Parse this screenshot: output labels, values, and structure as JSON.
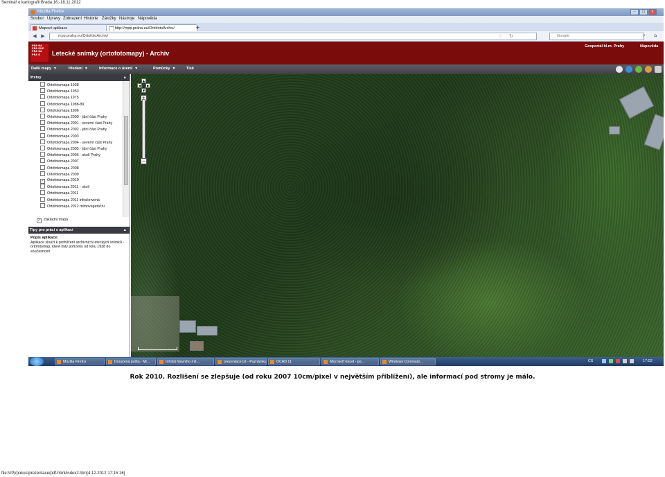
{
  "doc_header": "Seminář o kartografii Brada 16.-18.11.2012",
  "doc_footer": "file:///P|/pokus/prezentace/pdf-html/index2.htm[4.12.2012 17:15:16]",
  "caption": "Rok 2010. Rozlišení se zlepšuje (od roku 2007 10cm/pixel v největším přiblížení), ale informací pod stromy je málo.",
  "browser": {
    "window_title": "Mozilla Firefox",
    "menu": [
      "Soubor",
      "Úpravy",
      "Zobrazení",
      "Historie",
      "Záložky",
      "Nástroje",
      "Nápověda"
    ],
    "tabs": [
      "Mapové aplikace",
      "http://mpp.praha.eu/OrtofotoArchiv/"
    ],
    "new_tab": "+",
    "url": "mpp.praha.eu/OrtofotoArchiv/",
    "search_placeholder": "Google"
  },
  "app": {
    "logo_text": "PRA HA PRA GUE PRA GA PRA G",
    "title": "Letecké snímky (ortofotomapy) - Archiv",
    "portal_link": "Geoportál hl.m. Prahy",
    "help_link": "Nápověda",
    "toolbar": [
      "Další mapy",
      "Hledání",
      "Informace o území",
      "Pomůcky",
      "Tisk"
    ]
  },
  "sidebar": {
    "layers_heading": "Vrstvy",
    "layers": [
      {
        "label": "Ortofotomapa 1938",
        "checked": false
      },
      {
        "label": "Ortofotomapa 1953",
        "checked": false
      },
      {
        "label": "Ortofotomapa 1975",
        "checked": false
      },
      {
        "label": "Ortofotomapa 1988-89",
        "checked": false
      },
      {
        "label": "Ortofotomapa 1996",
        "checked": false
      },
      {
        "label": "Ortofotomapa 2000 - jižní část Prahy",
        "checked": false
      },
      {
        "label": "Ortofotomapa 2001 - severní část Prahy",
        "checked": false
      },
      {
        "label": "Ortofotomapa 2002 - jižní část Prahy",
        "checked": false
      },
      {
        "label": "Ortofotomapa 2003",
        "checked": false
      },
      {
        "label": "Ortofotomapa 2004 - severní část Prahy",
        "checked": false
      },
      {
        "label": "Ortofotomapa 2005 - jižní část Prahy",
        "checked": false
      },
      {
        "label": "Ortofotomapa 2006 - okolí Prahy",
        "checked": false
      },
      {
        "label": "Ortofotomapa 2007",
        "checked": false
      },
      {
        "label": "Ortofotomapa 2008",
        "checked": false
      },
      {
        "label": "Ortofotomapa 2009",
        "checked": false
      },
      {
        "label": "Ortofotomapa 2010",
        "checked": true
      },
      {
        "label": "Ortofotomapa 2011 - okolí",
        "checked": false
      },
      {
        "label": "Ortofotomapa 2011",
        "checked": false
      },
      {
        "label": "Ortofotomapa 2011 infračervená",
        "checked": false
      },
      {
        "label": "Ortofotomapa 2012 mimovegetační",
        "checked": false
      }
    ],
    "basemap": {
      "label": "Základní mapa",
      "checked": true
    },
    "tips_heading": "Tipy pro práci s aplikací",
    "tips_title": "Popis aplikace:",
    "tips_text": "Aplikace slouží k prohlížení archivních leteckých snímků - ortofotomap, které byly pořízeny od roku 1938 do současnosti."
  },
  "taskbar": {
    "items": [
      "Mozilla Firefox",
      "Doručená pošta - Mi...",
      "Infolist hlavního mě...",
      "prezentace.txt - Poznámky",
      "OCAD 11",
      "Microsoft Excel - po...",
      "Windows Communi..."
    ],
    "language": "CS",
    "clock": "17:02"
  },
  "colors": {
    "header_red": "#7a0c0c",
    "toolbar_dark": "#3f3f46",
    "taskbar_blue": "#203a63"
  }
}
